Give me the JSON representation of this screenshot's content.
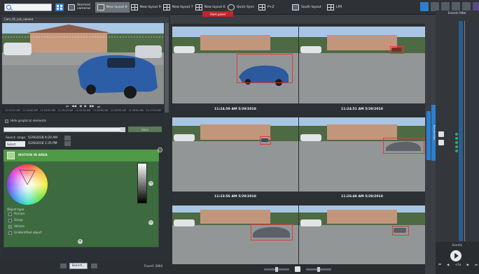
{
  "toolbar": {
    "tabs": [
      {
        "label": "Alarmed cameras",
        "icon": "camera-alert-icon"
      },
      {
        "label": "New layout 8",
        "icon": "camera-icon"
      },
      {
        "label": "New layout 9",
        "icon": "layout-icon"
      },
      {
        "label": "New layout 7",
        "icon": "layout-icon"
      },
      {
        "label": "New layout 6",
        "icon": "layout-icon"
      },
      {
        "label": "Quick Sync",
        "icon": "sync-icon"
      },
      {
        "label": "P+Z",
        "icon": "layout-icon"
      },
      {
        "label": "South layout",
        "icon": "camera-icon"
      },
      {
        "label": "LPR",
        "icon": "layout-icon"
      }
    ],
    "alert_tab": "Alert panel",
    "accent": "#2b7fcf"
  },
  "left": {
    "video_title": "Cam_01_Lot_camera",
    "player_timestamps": [
      "11:24:20 AM",
      "11:24:40 AM",
      "11:25:00 AM",
      "11:25:20 AM",
      "11:25:40 AM",
      "11:26:00 AM",
      "11:26:20 AM",
      "11:26:40 AM",
      "11:27:00 AM"
    ],
    "hide_graphical": "Hide graphical elements",
    "save_label": "Save",
    "search_range_label": "Search range:",
    "select_label": "Select",
    "date_from": "5/29/2018  9:20 AM",
    "date_to": "5/29/2018  1:35 PM",
    "motion_title": "MOTION IN AREA",
    "object_type_label": "Object type",
    "object_types": [
      {
        "label": "Human",
        "checked": false
      },
      {
        "label": "Group",
        "checked": false
      },
      {
        "label": "Vehicle",
        "checked": true
      },
      {
        "label": "Unidentified object",
        "checked": false
      }
    ],
    "search_button": "Search...",
    "found_text": "Found: 2664"
  },
  "grid": {
    "cameras": [
      {
        "timestamp": "11:24:59 AM 5/29/2018",
        "highlight": "blue sedan"
      },
      {
        "timestamp": "11:24:51 AM 5/29/2018",
        "highlight": "distant car"
      },
      {
        "timestamp": "11:23:56 AM 5/29/2018",
        "highlight": "distant car"
      },
      {
        "timestamp": "11:26:48 AM 5/29/2018",
        "highlight": "gray sedan"
      },
      {
        "timestamp": "",
        "highlight": "gray sedan"
      },
      {
        "timestamp": "",
        "highlight": "distant car"
      }
    ]
  },
  "side_tab": "Events filter",
  "events": {
    "title": "Events filter",
    "footer_label": "Events",
    "transport": [
      "⏮",
      "◀",
      "+1x",
      "▶",
      "⏭"
    ]
  }
}
